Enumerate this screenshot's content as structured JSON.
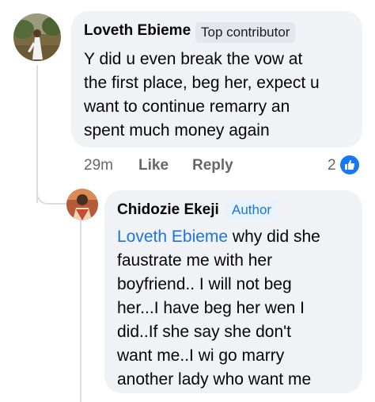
{
  "comment": {
    "author": "Loveth Ebieme",
    "badge": "Top contributor",
    "lines": [
      "Y did u even break the vow at",
      "the first place, beg her, expect u",
      "want to continue remarry an",
      "spent much money again"
    ],
    "time": "29m",
    "like_label": "Like",
    "reply_label": "Reply",
    "reaction_count": "2"
  },
  "reply": {
    "author": "Chidozie Ekeji",
    "badge": "Author",
    "mention": "Loveth Ebieme",
    "first_line_rest": " why did she",
    "lines": [
      "faustrate me with her",
      "boyfriend.. I will not beg",
      "her...I have beg her wen I",
      "did..If she say she don't",
      "want me..I wi go marry",
      "another lady who want me"
    ]
  },
  "colors": {
    "bubble": "#f0f2f5",
    "mention": "#1b74e4",
    "like_icon": "#1877f2",
    "meta_text": "#65676b"
  },
  "icons": {
    "reaction": "like-thumb-icon"
  }
}
